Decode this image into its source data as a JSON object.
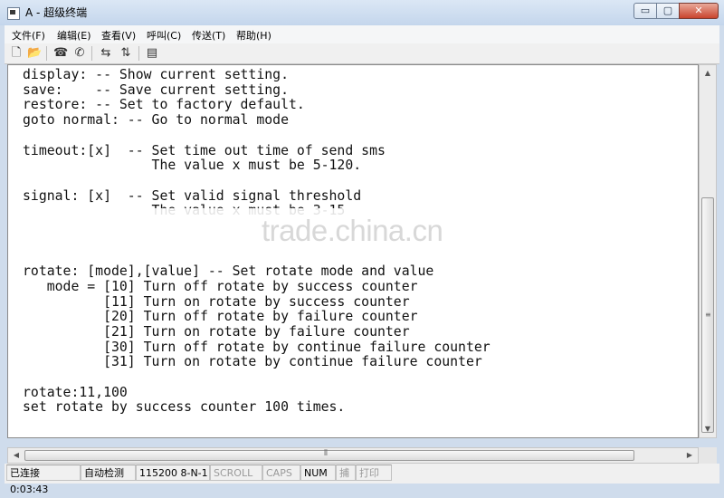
{
  "window": {
    "title": "A - 超级终端",
    "minimize_glyph": "▭",
    "maximize_glyph": "▢",
    "close_glyph": "✕"
  },
  "menu": {
    "items": [
      "文件(F)",
      "编辑(E)",
      "查看(V)",
      "呼叫(C)",
      "传送(T)",
      "帮助(H)"
    ]
  },
  "toolbar": {
    "icons": [
      {
        "name": "new-file-icon",
        "glyph": "🗋"
      },
      {
        "name": "open-folder-icon",
        "glyph": "📂"
      },
      {
        "name": "call-icon",
        "glyph": "☎"
      },
      {
        "name": "disconnect-icon",
        "glyph": "✆"
      },
      {
        "name": "send-icon",
        "glyph": "⇆"
      },
      {
        "name": "receive-icon",
        "glyph": "⇅"
      },
      {
        "name": "properties-icon",
        "glyph": "▤"
      }
    ]
  },
  "terminal": {
    "lines": [
      "display: -- Show current setting.",
      "save:    -- Save current setting.",
      "restore: -- Set to factory default.",
      "goto normal: -- Go to normal mode",
      "",
      "timeout:[x]  -- Set time out time of send sms",
      "                The value x must be 5-120.",
      "",
      "signal: [x]  -- Set valid signal threshold",
      "                The value x must be 3-15",
      "",
      "",
      "",
      "rotate: [mode],[value] -- Set rotate mode and value",
      "   mode = [10] Turn off rotate by success counter",
      "          [11] Turn on rotate by success counter",
      "          [20] Turn off rotate by failure counter",
      "          [21] Turn on rotate by failure counter",
      "          [30] Turn off rotate by continue failure counter",
      "          [31] Turn on rotate by continue failure counter",
      "",
      "rotate:11,100",
      "set rotate by success counter 100 times."
    ],
    "watermark": "trade.china.cn"
  },
  "scrollbars": {
    "up_glyph": "▲",
    "down_glyph": "▼",
    "left_glyph": "◀",
    "right_glyph": "▶",
    "grip_glyph": "≡",
    "hgrip_glyph": "⦀"
  },
  "statusbar": {
    "connected": "已连接 0:03:43",
    "auto_detect": "自动检测",
    "port_settings": "115200 8-N-1",
    "scroll": "SCROLL",
    "caps": "CAPS",
    "num": "NUM",
    "capture": "捕",
    "print": "打印"
  }
}
